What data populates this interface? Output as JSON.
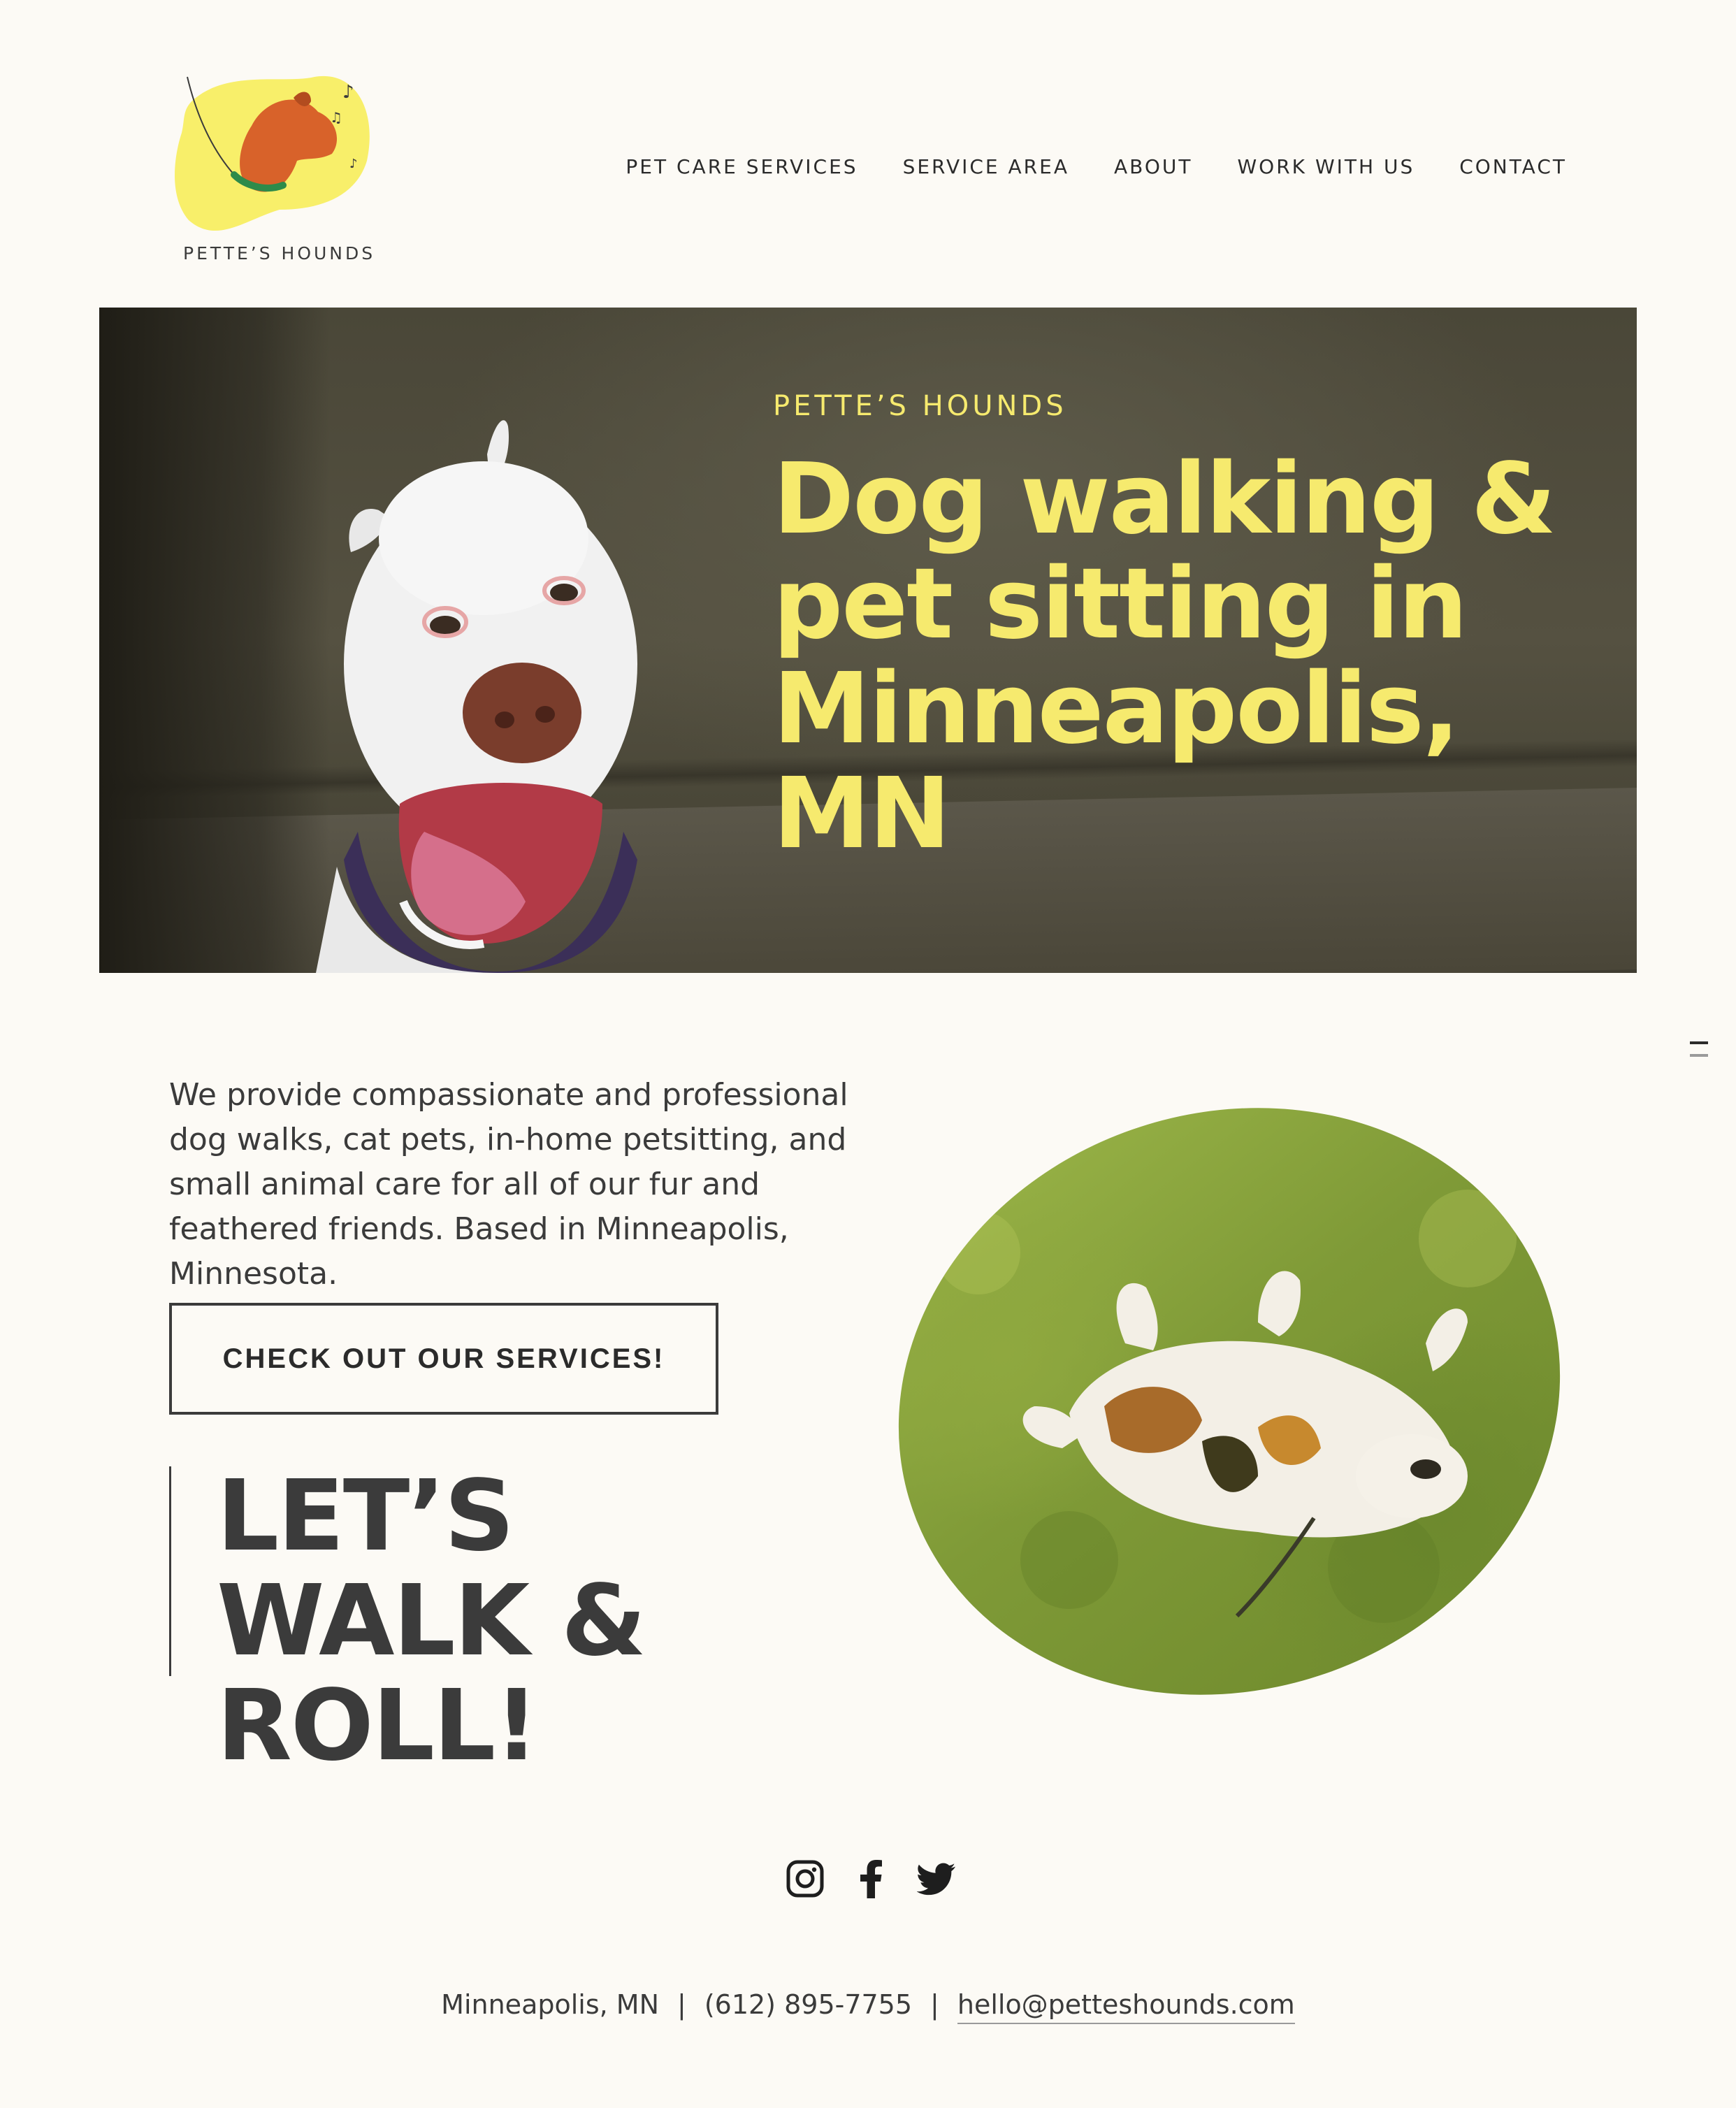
{
  "brand": {
    "logo_text": "PETTE’S HOUNDS"
  },
  "nav": {
    "items": [
      {
        "label": "PET CARE SERVICES"
      },
      {
        "label": "SERVICE AREA"
      },
      {
        "label": "ABOUT"
      },
      {
        "label": "WORK WITH US"
      },
      {
        "label": "CONTACT"
      }
    ]
  },
  "hero": {
    "kicker": "PETTE’S HOUNDS",
    "title": "Dog walking & pet sitting in Minneapolis, MN"
  },
  "intro": {
    "text": "We provide compassionate and professional dog walks, cat pets, in-home petsitting, and small animal care for all of our fur and feathered friends. Based in Minneapolis, Minnesota.",
    "cta_label": "CHECK OUT OUR SERVICES!",
    "tagline": "LET’S WALK & ROLL!"
  },
  "social": {
    "icons": [
      "instagram-icon",
      "facebook-icon",
      "twitter-icon"
    ]
  },
  "footer": {
    "location": "Minneapolis, MN",
    "separator": "|",
    "phone": "(612) 895-7755",
    "email": "hello@petteshounds.com"
  },
  "colors": {
    "background": "#fcfaf5",
    "accent_yellow": "#f6ea6e",
    "text": "#3b3b3b"
  }
}
